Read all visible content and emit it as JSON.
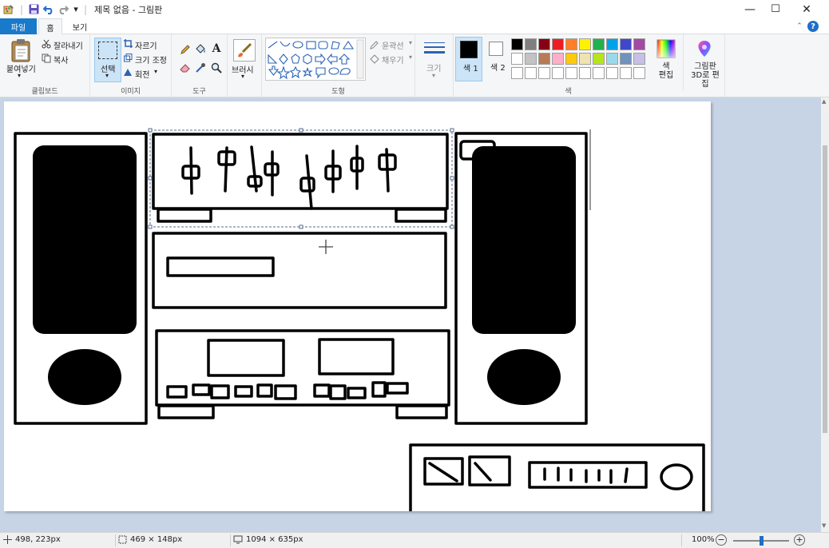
{
  "window": {
    "title": "제목 없음 - 그림판",
    "minimize_glyph": "—",
    "maximize_glyph": "☐",
    "close_glyph": "✕"
  },
  "quick_access": {
    "dropdown_glyph": "▾",
    "divider": "|"
  },
  "tabs": {
    "file": "파일",
    "home": "홈",
    "view": "보기"
  },
  "ribbon": {
    "collapse_glyph": "⌃",
    "help_glyph": "?",
    "clipboard": {
      "paste": "붙여넣기",
      "cut": "잘라내기",
      "copy": "복사",
      "group_label": "클립보드"
    },
    "image": {
      "select": "선택",
      "crop": "자르기",
      "resize": "크기 조정",
      "rotate": "회전",
      "group_label": "이미지"
    },
    "tools": {
      "group_label": "도구"
    },
    "brushes": {
      "label": "브러시"
    },
    "shapes": {
      "outline": "윤곽선",
      "fill": "채우기",
      "group_label": "도형"
    },
    "size": {
      "label": "크기"
    },
    "colors": {
      "color1": "색 1",
      "color2": "색 2",
      "edit_colors": "색 편집",
      "paint3d": "그림판 3D로 편집",
      "group_label": "색",
      "color1_value": "#000000",
      "color2_value": "#ffffff",
      "palette_row1": [
        "#000000",
        "#7f7f7f",
        "#880015",
        "#ed1c24",
        "#ff7f27",
        "#fff200",
        "#22b14c",
        "#00a2e8",
        "#3f48cc",
        "#a349a4"
      ],
      "palette_row2": [
        "#ffffff",
        "#c3c3c3",
        "#b97a57",
        "#ffaec9",
        "#ffc90e",
        "#efe4b0",
        "#b5e61d",
        "#99d9ea",
        "#7092be",
        "#c8bfe7"
      ],
      "palette_row3": [
        "#ffffff",
        "#ffffff",
        "#ffffff",
        "#ffffff",
        "#ffffff",
        "#ffffff",
        "#ffffff",
        "#ffffff",
        "#ffffff",
        "#ffffff"
      ]
    }
  },
  "status": {
    "cursor_pos": "498, 223px",
    "selection_size": "469 × 148px",
    "image_size": "1094 × 635px",
    "zoom": "100%",
    "zoom_out_glyph": "−",
    "zoom_in_glyph": "+",
    "zoom_level": 0.29
  }
}
